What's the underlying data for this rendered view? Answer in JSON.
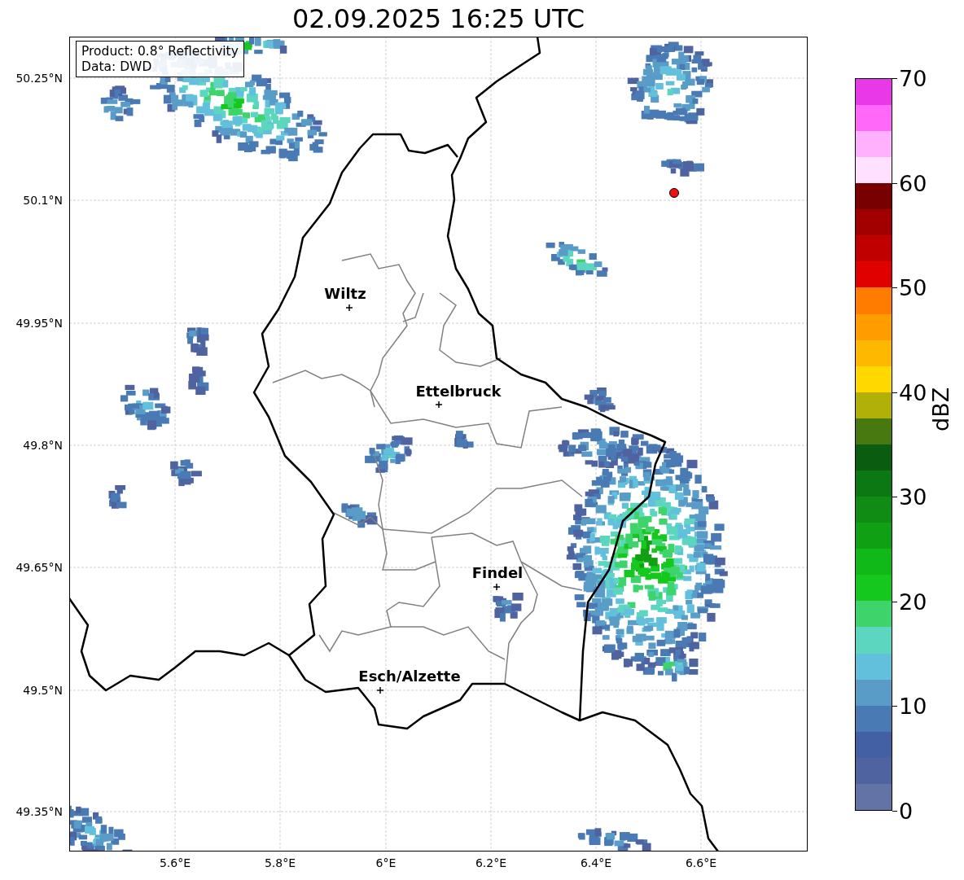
{
  "title": "02.09.2025 16:25 UTC",
  "info_box": [
    "Product: 0.8° Reflectivity",
    "Data: DWD"
  ],
  "y_ticks": [
    "50.25°N",
    "50.1°N",
    "49.95°N",
    "49.8°N",
    "49.65°N",
    "49.5°N",
    "49.35°N"
  ],
  "x_ticks": [
    "5.6°E",
    "5.8°E",
    "6°E",
    "6.2°E",
    "6.4°E",
    "6.6°E"
  ],
  "cities": [
    "Wiltz",
    "Ettelbruck",
    "Findel",
    "Esch/Alzette"
  ],
  "colorbar": {
    "label": "dBZ",
    "ticks": [
      "70",
      "60",
      "50",
      "40",
      "30",
      "20",
      "10",
      "0"
    ],
    "segments": [
      {
        "color": "#6473a6"
      },
      {
        "color": "#4f63a0"
      },
      {
        "color": "#4360a4"
      },
      {
        "color": "#4a7ab4"
      },
      {
        "color": "#5a9cc8"
      },
      {
        "color": "#62c0dc"
      },
      {
        "color": "#5dd6c0"
      },
      {
        "color": "#3dd46c"
      },
      {
        "color": "#14c81e"
      },
      {
        "color": "#10b818"
      },
      {
        "color": "#10a014"
      },
      {
        "color": "#108c14"
      },
      {
        "color": "#0c7814"
      },
      {
        "color": "#0a5c10"
      },
      {
        "color": "#487810"
      },
      {
        "color": "#b0b008"
      },
      {
        "color": "#ffd800"
      },
      {
        "color": "#ffb800"
      },
      {
        "color": "#ff9c00"
      },
      {
        "color": "#ff7c00"
      },
      {
        "color": "#e00000"
      },
      {
        "color": "#c00000"
      },
      {
        "color": "#a00000"
      },
      {
        "color": "#780000"
      },
      {
        "color": "#ffe0ff"
      },
      {
        "color": "#ffb0ff"
      },
      {
        "color": "#ff68f8"
      },
      {
        "color": "#e838e8"
      }
    ]
  }
}
